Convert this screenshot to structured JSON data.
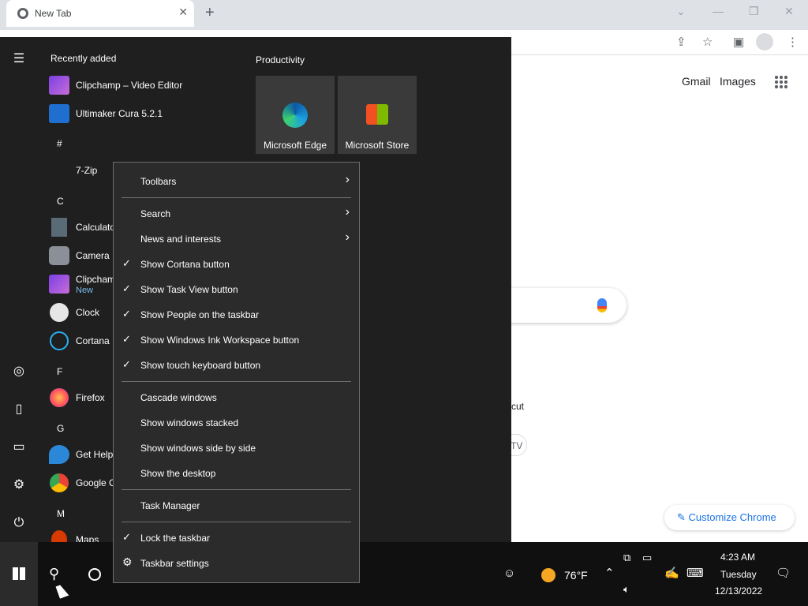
{
  "browser": {
    "tab_title": "New Tab",
    "new_tab_label": "+",
    "links": [
      "Gmail",
      "Images"
    ],
    "shortcut_fragment": "cut",
    "chip_fragment": "TV",
    "customize_label": "Customize Chrome"
  },
  "start_menu": {
    "recent_header": "Recently added",
    "recent_items": [
      {
        "label": "Clipchamp – Video Editor",
        "icon": "clipchamp-icon"
      },
      {
        "label": "Ultimaker Cura 5.2.1",
        "icon": "cura-icon"
      }
    ],
    "letters": {
      "hash": "#",
      "c": "C",
      "f": "F",
      "g": "G",
      "m": "M"
    },
    "apps": [
      {
        "label": "7-Zip",
        "icon": "folder-icon"
      },
      {
        "label": "Calculator",
        "icon": "calculator-icon"
      },
      {
        "label": "Camera",
        "icon": "camera-icon"
      },
      {
        "label": "Clipchamp",
        "sub": "New",
        "icon": "clipchamp-icon"
      },
      {
        "label": "Clock",
        "icon": "clock-icon"
      },
      {
        "label": "Cortana",
        "icon": "cortana-icon"
      },
      {
        "label": "Firefox",
        "icon": "firefox-icon"
      },
      {
        "label": "Get Help",
        "icon": "help-icon"
      },
      {
        "label": "Google Chrome",
        "icon": "chrome-icon"
      },
      {
        "label": "Maps",
        "icon": "maps-icon"
      }
    ],
    "productivity_header": "Productivity",
    "tiles": [
      {
        "label": "Microsoft Edge",
        "icon": "edge-icon"
      },
      {
        "label": "Microsoft Store",
        "icon": "store-icon"
      }
    ]
  },
  "context_menu": {
    "toolbars": "Toolbars",
    "search": "Search",
    "news": "News and interests",
    "cortana": "Show Cortana button",
    "task_view": "Show Task View button",
    "people": "Show People on the taskbar",
    "ink": "Show Windows Ink Workspace button",
    "touch_keyboard": "Show touch keyboard button",
    "cascade": "Cascade windows",
    "stacked": "Show windows stacked",
    "side_by_side": "Show windows side by side",
    "desktop": "Show the desktop",
    "task_manager": "Task Manager",
    "lock": "Lock the taskbar",
    "settings": "Taskbar settings",
    "check_glyph": "✓",
    "arrow_glyph": "›",
    "gear_glyph": "⚙"
  },
  "taskbar": {
    "weather": "76°F",
    "time": "4:23 AM",
    "day": "Tuesday",
    "date": "12/13/2022"
  },
  "colors": {
    "start_bg": "#1f1f1f",
    "menu_bg": "#2b2b2b",
    "taskbar_bg": "#101010",
    "accent": "#1a73e8"
  }
}
